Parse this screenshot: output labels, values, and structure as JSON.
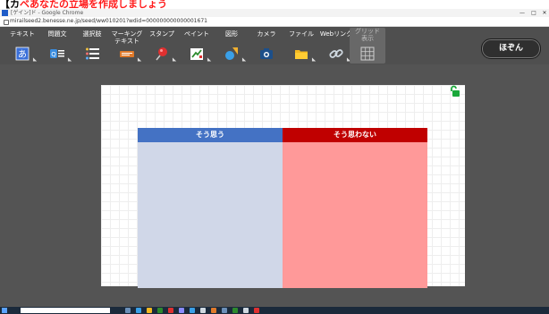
{
  "heading": {
    "prefix": "【カ",
    "message": "ベあなたの立場を作成しましょう"
  },
  "browser": {
    "title": "[ゲイン]ド - Google Chrome",
    "url": "mirailseed2.benesse.ne.jp/seed/ww010201?wdid=000000000000001671",
    "controls": [
      "—",
      "□",
      "✕"
    ]
  },
  "toolbar": {
    "tools": [
      {
        "id": "text",
        "label": "テキスト",
        "icon": "text-a-icon"
      },
      {
        "id": "question",
        "label": "問題文",
        "icon": "question-q-icon"
      },
      {
        "id": "choice",
        "label": "選択肢",
        "icon": "choice-list-icon"
      },
      {
        "id": "marking",
        "label": "マーキング\nテキスト",
        "icon": "marking-text-icon"
      },
      {
        "id": "stamp",
        "label": "スタンプ",
        "icon": "stamp-pin-icon"
      },
      {
        "id": "paint",
        "label": "ペイント",
        "icon": "paint-icon"
      },
      {
        "id": "shape",
        "label": "図形",
        "icon": "shape-icon"
      },
      {
        "id": "camera",
        "label": "カメラ",
        "icon": "camera-icon"
      },
      {
        "id": "file",
        "label": "ファイル",
        "icon": "folder-icon"
      },
      {
        "id": "weblink",
        "label": "Webリンク",
        "icon": "link-icon"
      },
      {
        "id": "grid",
        "label": "グリッド\n表示",
        "icon": "grid-icon"
      }
    ],
    "save_label": "ほぞん"
  },
  "canvas": {
    "columns": [
      {
        "label": "そう思う",
        "header_color": "#4472c4",
        "body_color": "#d0d7e8"
      },
      {
        "label": "そう思わない",
        "header_color": "#c00000",
        "body_color": "#ff9999"
      }
    ]
  },
  "colors": {
    "toolbar": "#4f4f4f",
    "workspace": "#545454",
    "lock": "#1aa83a"
  }
}
